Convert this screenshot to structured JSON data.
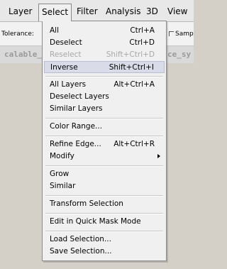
{
  "menubar": {
    "items": [
      {
        "label": "Layer"
      },
      {
        "label": "Select"
      },
      {
        "label": "Filter"
      },
      {
        "label": "Analysis"
      },
      {
        "label": "3D"
      },
      {
        "label": "View"
      }
    ]
  },
  "options_bar": {
    "tolerance_label": "Tolerance:",
    "sample_label": "Samp"
  },
  "doc_bar": {
    "left_text": "calable_",
    "right_text": "ce_sy"
  },
  "select_menu": {
    "items": [
      {
        "label": "All",
        "shortcut": "Ctrl+A"
      },
      {
        "label": "Deselect",
        "shortcut": "Ctrl+D"
      },
      {
        "label": "Reselect",
        "shortcut": "Shift+Ctrl+D"
      },
      {
        "label": "Inverse",
        "shortcut": "Shift+Ctrl+I"
      },
      {
        "label": "All Layers",
        "shortcut": "Alt+Ctrl+A"
      },
      {
        "label": "Deselect Layers",
        "shortcut": ""
      },
      {
        "label": "Similar Layers",
        "shortcut": ""
      },
      {
        "label": "Color Range...",
        "shortcut": ""
      },
      {
        "label": "Refine Edge...",
        "shortcut": "Alt+Ctrl+R"
      },
      {
        "label": "Modify",
        "shortcut": ""
      },
      {
        "label": "Grow",
        "shortcut": ""
      },
      {
        "label": "Similar",
        "shortcut": ""
      },
      {
        "label": "Transform Selection",
        "shortcut": ""
      },
      {
        "label": "Edit in Quick Mask Mode",
        "shortcut": ""
      },
      {
        "label": "Load Selection...",
        "shortcut": ""
      },
      {
        "label": "Save Selection...",
        "shortcut": ""
      }
    ]
  },
  "colors": {
    "menu_bg": "#f0f0f0",
    "hover_bg": "#d9dbe8",
    "disabled_text": "#a8a8a8"
  }
}
